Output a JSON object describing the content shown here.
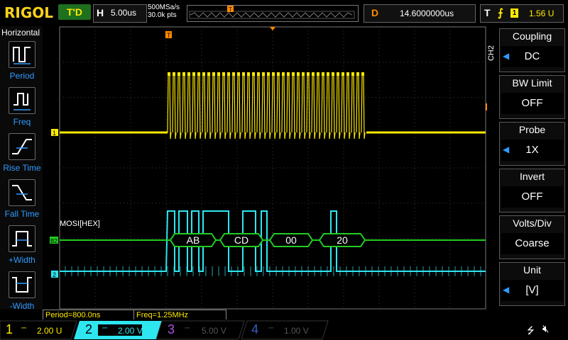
{
  "brand": "RIGOL",
  "run_state": "T'D",
  "horizontal": {
    "label": "H",
    "timebase": "5.00us",
    "sample_rate": "500MSa/s",
    "points": "30.0k pts"
  },
  "delay": {
    "label": "D",
    "value": "14.6000000us"
  },
  "trigger": {
    "label": "T",
    "source": "1",
    "level": "1.56 U"
  },
  "left_menu": {
    "title": "Horizontal",
    "items": [
      "Period",
      "Freq",
      "Rise Time",
      "Fall Time",
      "+Width",
      "-Width"
    ]
  },
  "right_menu": {
    "channel": "CH2",
    "items": [
      {
        "title": "Coupling",
        "value": "DC"
      },
      {
        "title": "BW Limit",
        "value": "OFF"
      },
      {
        "title": "Probe",
        "value": "1X"
      },
      {
        "title": "Invert",
        "value": "OFF"
      },
      {
        "title": "Volts/Div",
        "value": "Coarse"
      },
      {
        "title": "Unit",
        "value": "[V]"
      }
    ]
  },
  "decode": {
    "label": "MOSI[HEX]",
    "bytes": [
      "AB",
      "CD",
      "00",
      "20"
    ]
  },
  "markers": {
    "ch1": "1",
    "ch2": "2",
    "bus": "B2",
    "trig": "T"
  },
  "measurements": {
    "period": "Period=800.0ns",
    "freq": "Freq=1.25MHz"
  },
  "channels": [
    {
      "num": "1",
      "scale": "2.00 U",
      "color": "#ffea00"
    },
    {
      "num": "2",
      "scale": "2.00 V",
      "color": "#2ee6f0"
    },
    {
      "num": "3",
      "scale": "5.00 V",
      "color": "#b04ee6"
    },
    {
      "num": "4",
      "scale": "1.00 V",
      "color": "#3a5cc7"
    }
  ],
  "colors": {
    "ch1": "#ffea00",
    "ch2": "#2ee6f0",
    "decode": "#22cc22",
    "trigger": "#ff8a00"
  }
}
